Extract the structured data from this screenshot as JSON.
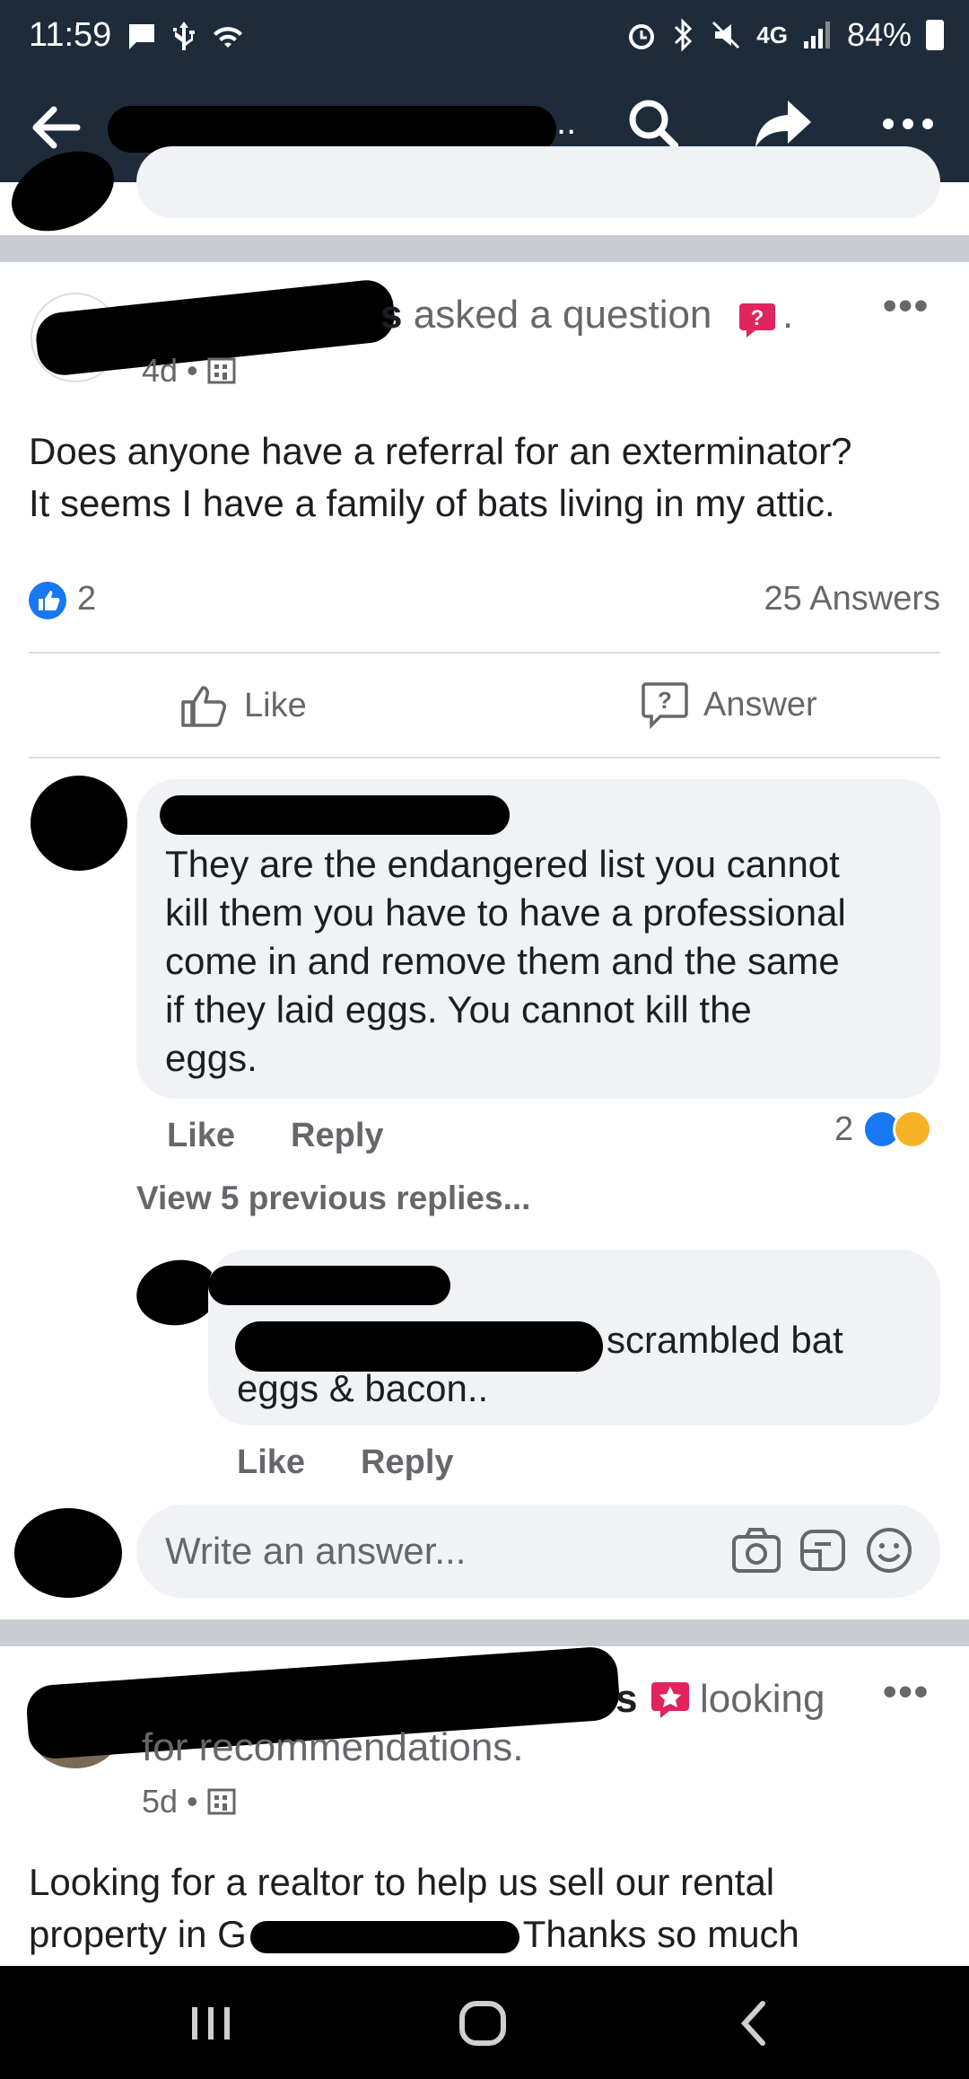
{
  "status_bar": {
    "time": "11:59",
    "network": "4G",
    "battery": "84%"
  },
  "app_bar": {
    "title_suffix": "...",
    "icons": [
      "back-arrow-icon",
      "search-icon",
      "share-icon",
      "more-icon"
    ]
  },
  "post1": {
    "author_suffix": "s",
    "action_text": "asked a question",
    "age": "4d",
    "body_line1": "Does anyone have a referral for an exterminator?",
    "body_line2": "It seems I have a family of bats living in my attic.",
    "like_count": "2",
    "answers_count": "25 Answers",
    "like_label": "Like",
    "answer_label": "Answer"
  },
  "comment1": {
    "lines": [
      "They are the endangered list you cannot",
      "kill them you have to have a professional",
      "come in and remove them and the same",
      "if they laid eggs. You cannot kill the",
      "eggs."
    ],
    "like_label": "Like",
    "reply_label": "Reply",
    "reaction_count": "2"
  },
  "view_previous_replies": "View 5 previous replies...",
  "reply1": {
    "line1_suffix": "scrambled bat",
    "line2": "eggs & bacon..",
    "like_label": "Like",
    "reply_label": "Reply"
  },
  "answer_composer": {
    "placeholder": "Write an answer..."
  },
  "post2": {
    "author_suffix": "s",
    "action_text": "looking",
    "action_text_line2": "for recommendations.",
    "age": "5d",
    "body_line1": "Looking for a realtor to help us sell our rental",
    "body_line2_prefix": "property in G",
    "body_line2_suffix": "Thanks so much"
  },
  "colors": {
    "app_bar": "#1d2b3a",
    "fb_blue": "#1877f2",
    "question_badge": "#e0245e",
    "bubble_bg": "#f0f2f5",
    "secondary_text": "#65676b"
  }
}
